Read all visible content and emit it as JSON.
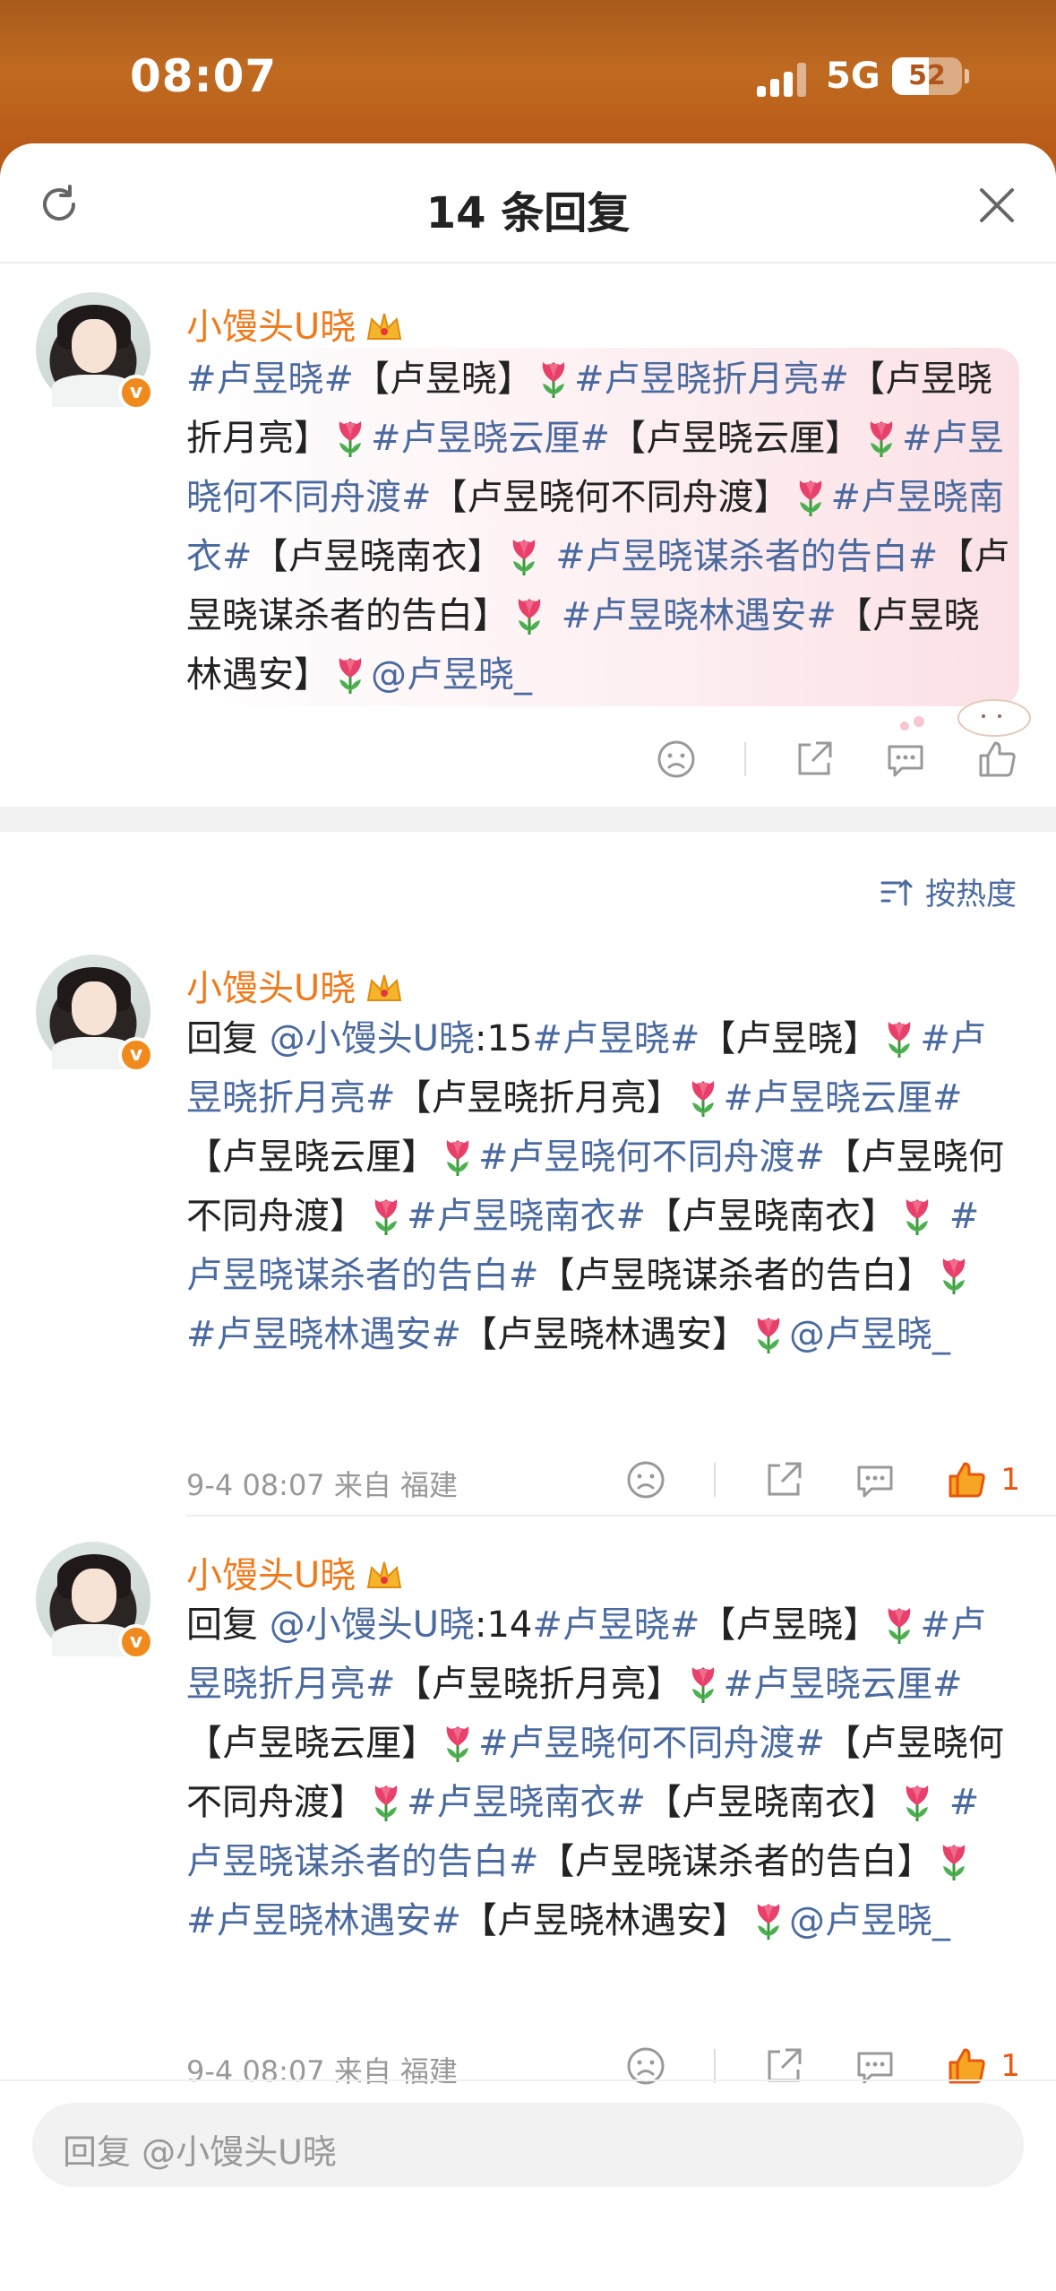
{
  "status_bar": {
    "time": "08:07",
    "network": "5G",
    "battery": "52",
    "battery_level_percent": 52
  },
  "sheet": {
    "title": "14 条回复",
    "sort_label": "按热度"
  },
  "main_comment": {
    "username": "小馒头ᑌ晓",
    "segments": [
      {
        "t": "topic",
        "v": "#卢昱晓#"
      },
      {
        "t": "text",
        "v": "【卢昱晓】"
      },
      {
        "t": "tulip"
      },
      {
        "t": "topic",
        "v": "#卢昱晓折月亮#"
      },
      {
        "t": "text",
        "v": "【卢昱晓折月亮】"
      },
      {
        "t": "tulip"
      },
      {
        "t": "topic",
        "v": "#卢昱晓云厘#"
      },
      {
        "t": "text",
        "v": "【卢昱晓云厘】"
      },
      {
        "t": "tulip"
      },
      {
        "t": "topic",
        "v": "#卢昱晓何不同舟渡#"
      },
      {
        "t": "text",
        "v": "【卢昱晓何不同舟渡】"
      },
      {
        "t": "tulip"
      },
      {
        "t": "topic",
        "v": "#卢昱晓南衣#"
      },
      {
        "t": "text",
        "v": "【卢昱晓南衣】"
      },
      {
        "t": "tulip"
      },
      {
        "t": "topic",
        "v": " #卢昱晓谋杀者的告白#"
      },
      {
        "t": "text",
        "v": "【卢昱晓谋杀者的告白】"
      },
      {
        "t": "tulip"
      },
      {
        "t": "topic",
        "v": " #卢昱晓林遇安#"
      },
      {
        "t": "text",
        "v": "【卢昱晓林遇安】"
      },
      {
        "t": "tulip"
      },
      {
        "t": "mention",
        "v": "@卢昱晓_"
      }
    ]
  },
  "replies": [
    {
      "username": "小馒头ᑌ晓",
      "reply_prefix": "回复 ",
      "reply_target": "@小馒头ᑌ晓",
      "reply_number": ":15",
      "meta": "9-4 08:07  来自 福建",
      "likes": "1",
      "segments": [
        {
          "t": "topic",
          "v": "#卢昱晓#"
        },
        {
          "t": "text",
          "v": "【卢昱晓】"
        },
        {
          "t": "tulip"
        },
        {
          "t": "topic",
          "v": "#卢昱晓折月亮#"
        },
        {
          "t": "text",
          "v": "【卢昱晓折月亮】"
        },
        {
          "t": "tulip"
        },
        {
          "t": "topic",
          "v": "#卢昱晓云厘#"
        },
        {
          "t": "text",
          "v": "【卢昱晓云厘】"
        },
        {
          "t": "tulip"
        },
        {
          "t": "topic",
          "v": "#卢昱晓何不同舟渡#"
        },
        {
          "t": "text",
          "v": "【卢昱晓何不同舟渡】"
        },
        {
          "t": "tulip"
        },
        {
          "t": "topic",
          "v": "#卢昱晓南衣#"
        },
        {
          "t": "text",
          "v": "【卢昱晓南衣】"
        },
        {
          "t": "tulip"
        },
        {
          "t": "topic",
          "v": " #卢昱晓谋杀者的告白#"
        },
        {
          "t": "text",
          "v": "【卢昱晓谋杀者的告白】"
        },
        {
          "t": "tulip"
        },
        {
          "t": "topic",
          "v": " #卢昱晓林遇安#"
        },
        {
          "t": "text",
          "v": "【卢昱晓林遇安】"
        },
        {
          "t": "tulip"
        },
        {
          "t": "mention",
          "v": "@卢昱晓_"
        }
      ]
    },
    {
      "username": "小馒头ᑌ晓",
      "reply_prefix": "回复 ",
      "reply_target": "@小馒头ᑌ晓",
      "reply_number": ":14",
      "meta": "9-4 08:07  来自 福建",
      "likes": "1",
      "segments": [
        {
          "t": "topic",
          "v": "#卢昱晓#"
        },
        {
          "t": "text",
          "v": "【卢昱晓】"
        },
        {
          "t": "tulip"
        },
        {
          "t": "topic",
          "v": "#卢昱晓折月亮#"
        },
        {
          "t": "text",
          "v": "【卢昱晓折月亮】"
        },
        {
          "t": "tulip"
        },
        {
          "t": "topic",
          "v": "#卢昱晓云厘#"
        },
        {
          "t": "text",
          "v": "【卢昱晓云厘】"
        },
        {
          "t": "tulip"
        },
        {
          "t": "topic",
          "v": "#卢昱晓何不同舟渡#"
        },
        {
          "t": "text",
          "v": "【卢昱晓何不同舟渡】"
        },
        {
          "t": "tulip"
        },
        {
          "t": "topic",
          "v": "#卢昱晓南衣#"
        },
        {
          "t": "text",
          "v": "【卢昱晓南衣】"
        },
        {
          "t": "tulip"
        },
        {
          "t": "topic",
          "v": " #卢昱晓谋杀者的告白#"
        },
        {
          "t": "text",
          "v": "【卢昱晓谋杀者的告白】"
        },
        {
          "t": "tulip"
        },
        {
          "t": "topic",
          "v": " #卢昱晓林遇安#"
        },
        {
          "t": "text",
          "v": "【卢昱晓林遇安】"
        },
        {
          "t": "tulip"
        },
        {
          "t": "mention",
          "v": "@卢昱晓_"
        }
      ]
    }
  ],
  "reply_input": {
    "placeholder": "回复 @小馒头ᑌ晓"
  },
  "colors": {
    "accent_orange": "#f07a1a",
    "link_blue": "#4a6aa0",
    "like_orange": "#e8560f"
  },
  "icons": [
    "refresh-icon",
    "close-icon",
    "crown-icon",
    "tulip-icon",
    "dislike-icon",
    "share-icon",
    "comment-icon",
    "like-icon",
    "sort-icon",
    "verified-badge"
  ]
}
